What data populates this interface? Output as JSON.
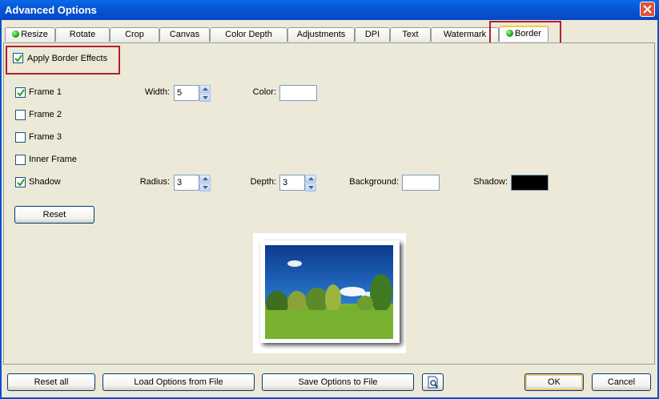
{
  "window": {
    "title": "Advanced Options"
  },
  "tabs": [
    {
      "label": "Resize",
      "has_dot": true
    },
    {
      "label": "Rotate"
    },
    {
      "label": "Crop"
    },
    {
      "label": "Canvas"
    },
    {
      "label": "Color Depth"
    },
    {
      "label": "Adjustments"
    },
    {
      "label": "DPI"
    },
    {
      "label": "Text"
    },
    {
      "label": "Watermark"
    },
    {
      "label": "Border",
      "has_dot": true,
      "active": true
    }
  ],
  "border": {
    "apply_label": "Apply Border Effects",
    "apply_checked": true,
    "frame1": {
      "label": "Frame 1",
      "checked": true
    },
    "frame2": {
      "label": "Frame 2",
      "checked": false
    },
    "frame3": {
      "label": "Frame 3",
      "checked": false
    },
    "inner_frame": {
      "label": "Inner Frame",
      "checked": false
    },
    "shadow": {
      "label": "Shadow",
      "checked": true
    },
    "width_label": "Width:",
    "width_value": "5",
    "color_label": "Color:",
    "color_value": "#FFFFFF",
    "radius_label": "Radius:",
    "radius_value": "3",
    "depth_label": "Depth:",
    "depth_value": "3",
    "background_label": "Background:",
    "background_value": "#FFFFFF",
    "shadow_color_label": "Shadow:",
    "shadow_color_value": "#000000",
    "reset_label": "Reset"
  },
  "footer": {
    "reset_all": "Reset all",
    "load_options": "Load Options from File",
    "save_options": "Save Options to File",
    "ok": "OK",
    "cancel": "Cancel"
  }
}
